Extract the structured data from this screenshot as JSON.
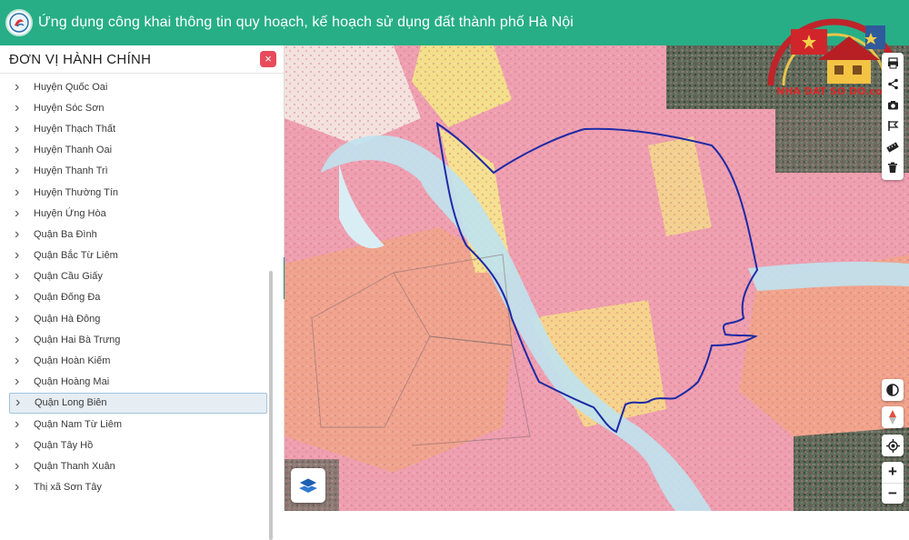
{
  "header": {
    "title": "Ứng dụng công khai thông tin quy hoạch, kế hoạch sử dụng đất thành phố Hà Nội"
  },
  "panel": {
    "title": "ĐƠN VỊ HÀNH CHÍNH",
    "close_label": "×",
    "items": [
      {
        "label": "Huyện Quốc Oai"
      },
      {
        "label": "Huyện Sóc Sơn"
      },
      {
        "label": "Huyện Thạch Thất"
      },
      {
        "label": "Huyện Thanh Oai"
      },
      {
        "label": "Huyện Thanh Trì"
      },
      {
        "label": "Huyện Thường Tín"
      },
      {
        "label": "Huyện Ứng Hòa"
      },
      {
        "label": "Quận Ba Đình"
      },
      {
        "label": "Quận Bắc Từ Liêm"
      },
      {
        "label": "Quận Cầu Giấy"
      },
      {
        "label": "Quận Đống Đa"
      },
      {
        "label": "Quận Hà Đông"
      },
      {
        "label": "Quận Hai Bà Trưng"
      },
      {
        "label": "Quận Hoàn Kiếm"
      },
      {
        "label": "Quận Hoàng Mai"
      },
      {
        "label": "Quận Long Biên"
      },
      {
        "label": "Quận Nam Từ Liêm"
      },
      {
        "label": "Quận Tây Hồ"
      },
      {
        "label": "Quận Thanh Xuân"
      },
      {
        "label": "Thị xã Sơn Tây"
      }
    ],
    "selected_item": "Quận Long Biên"
  },
  "map": {
    "zoom_in_label": "+",
    "zoom_out_label": "−"
  },
  "brand": {
    "text": "NHA DAT SO DO.com"
  },
  "colors": {
    "header": "#27ae86",
    "boundary": "#1d2aa6",
    "river": "#bfe3ef",
    "land_pink": "#f1a2b4",
    "land_salmon": "#f4a78f",
    "land_yellow": "#f5e28b"
  }
}
